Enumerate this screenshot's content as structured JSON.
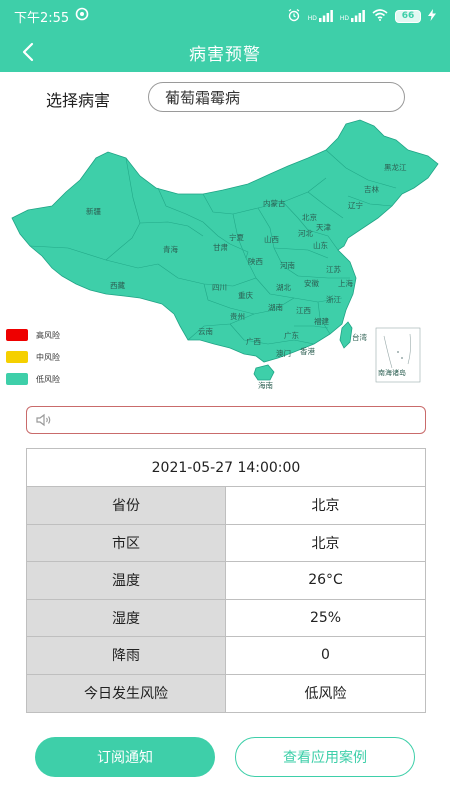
{
  "status_bar": {
    "time": "下午2:55",
    "battery": "66",
    "signal_labels": [
      "HD",
      "HD"
    ]
  },
  "nav": {
    "title": "病害预警"
  },
  "select": {
    "label": "选择病害",
    "value": "葡萄霜霉病"
  },
  "map": {
    "fill_color": "#3ecfa9",
    "border_color": "#1fa385",
    "provinces": [
      "新疆",
      "西藏",
      "青海",
      "甘肃",
      "宁夏",
      "内蒙古",
      "黑龙江",
      "吉林",
      "辽宁",
      "北京",
      "天津",
      "河北",
      "山西",
      "陕西",
      "山东",
      "河南",
      "江苏",
      "安徽",
      "上海",
      "湖北",
      "四川",
      "重庆",
      "贵州",
      "湖南",
      "江西",
      "浙江",
      "福建",
      "云南",
      "广西",
      "广东",
      "香港",
      "澳门",
      "台湾",
      "海南"
    ],
    "inset_label": "南海诸岛"
  },
  "legend": [
    {
      "label": "高风险",
      "color": "#ee0000"
    },
    {
      "label": "中风险",
      "color": "#f5d000"
    },
    {
      "label": "低风险",
      "color": "#3ecfa9"
    }
  ],
  "table": {
    "datetime": "2021-05-27 14:00:00",
    "rows": [
      {
        "key": "省份",
        "value": "北京"
      },
      {
        "key": "市区",
        "value": "北京"
      },
      {
        "key": "温度",
        "value": "26°C"
      },
      {
        "key": "湿度",
        "value": "25%"
      },
      {
        "key": "降雨",
        "value": "0"
      },
      {
        "key": "今日发生风险",
        "value": "低风险"
      }
    ]
  },
  "buttons": {
    "subscribe": "订阅通知",
    "cases": "查看应用案例"
  }
}
